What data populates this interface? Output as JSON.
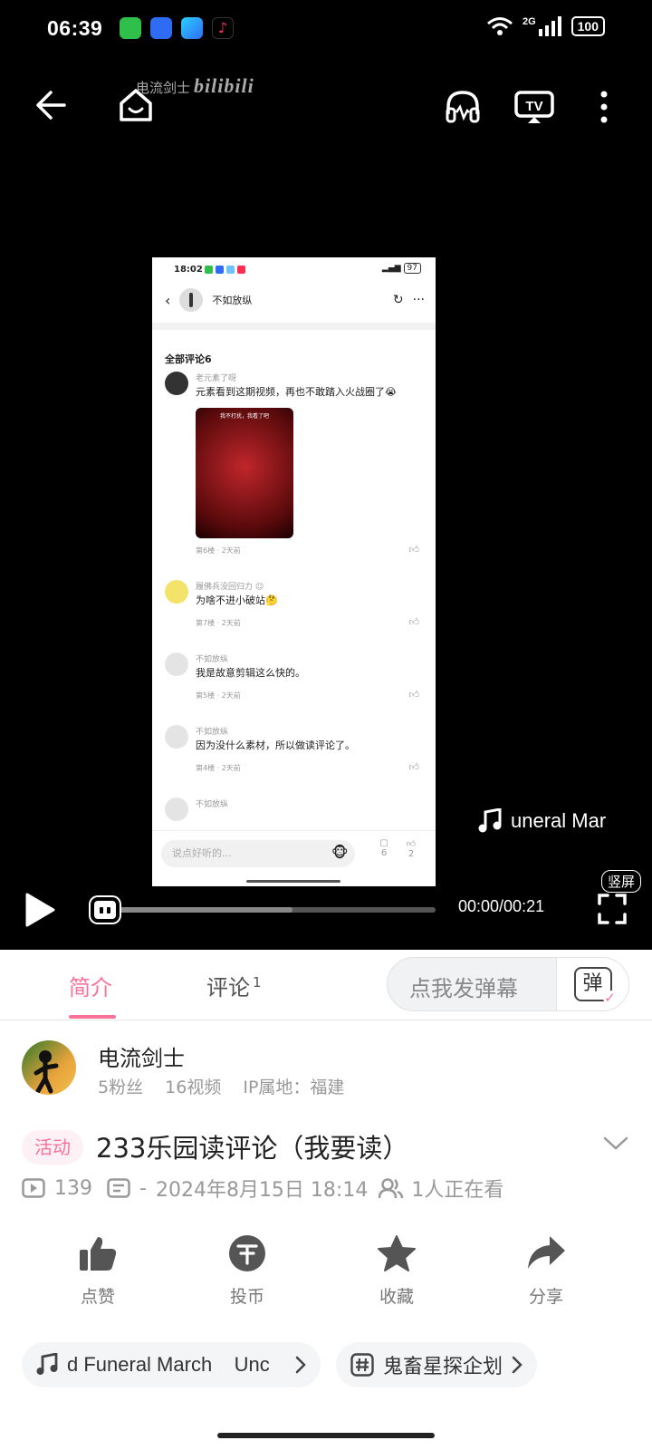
{
  "status_bar": {
    "time": "06:39",
    "network": "2G",
    "battery": "100"
  },
  "player": {
    "watermark_author": "电流剑士",
    "watermark_brand": "bilibili",
    "song_scroll": "uneral Mar",
    "vertical_badge": "竖屏",
    "time": "00:00/00:21",
    "progress_fraction": 0.56
  },
  "inner_video": {
    "status_time": "18:02",
    "battery": "97",
    "header_name": "不如放纵",
    "comments_title": "全部评论6",
    "comments": [
      {
        "name": "老元素了呀",
        "text": "元素看到这期视频，再也不敢踏入火战圈了😭",
        "meta": "第6楼 · 2天前",
        "image_caption": "我不打扰，我看了吧"
      },
      {
        "name": "履佛兵没回归力 ☺",
        "text": "为啥不进小破站🤔",
        "meta": "第7楼 · 2天前"
      },
      {
        "name": "不如放纵",
        "text": "我是故意剪辑这么快的。",
        "meta": "第5楼 · 2天前"
      },
      {
        "name": "不如放纵",
        "text": "因为没什么素材，所以做读评论了。",
        "meta": "第4楼 · 2天前"
      },
      {
        "name": "不如放纵"
      }
    ],
    "input_placeholder": "说点好听的...",
    "comment_count": "6",
    "like_count": "2"
  },
  "tabs": [
    {
      "label": "简介"
    },
    {
      "label": "评论",
      "count": "1"
    }
  ],
  "danmaku": {
    "placeholder": "点我发弹幕",
    "button_label": "弹"
  },
  "uploader": {
    "name": "电流剑士",
    "fans": "5粉丝",
    "videos": "16视频",
    "ip": "IP属地：福建"
  },
  "video": {
    "tag": "活动",
    "title": "233乐园读评论（我要读）",
    "plays": "139",
    "danmaku_count": "-",
    "date": "2024年8月15日 18:14",
    "watching": "1人正在看"
  },
  "actions": [
    {
      "label": "点赞"
    },
    {
      "label": "投币"
    },
    {
      "label": "收藏"
    },
    {
      "label": "分享"
    }
  ],
  "chips": {
    "music": "d Funeral March    Unc",
    "topic": "鬼畜星探企划"
  },
  "colors": {
    "accent": "#fb7299",
    "player_bg": "#000000"
  }
}
